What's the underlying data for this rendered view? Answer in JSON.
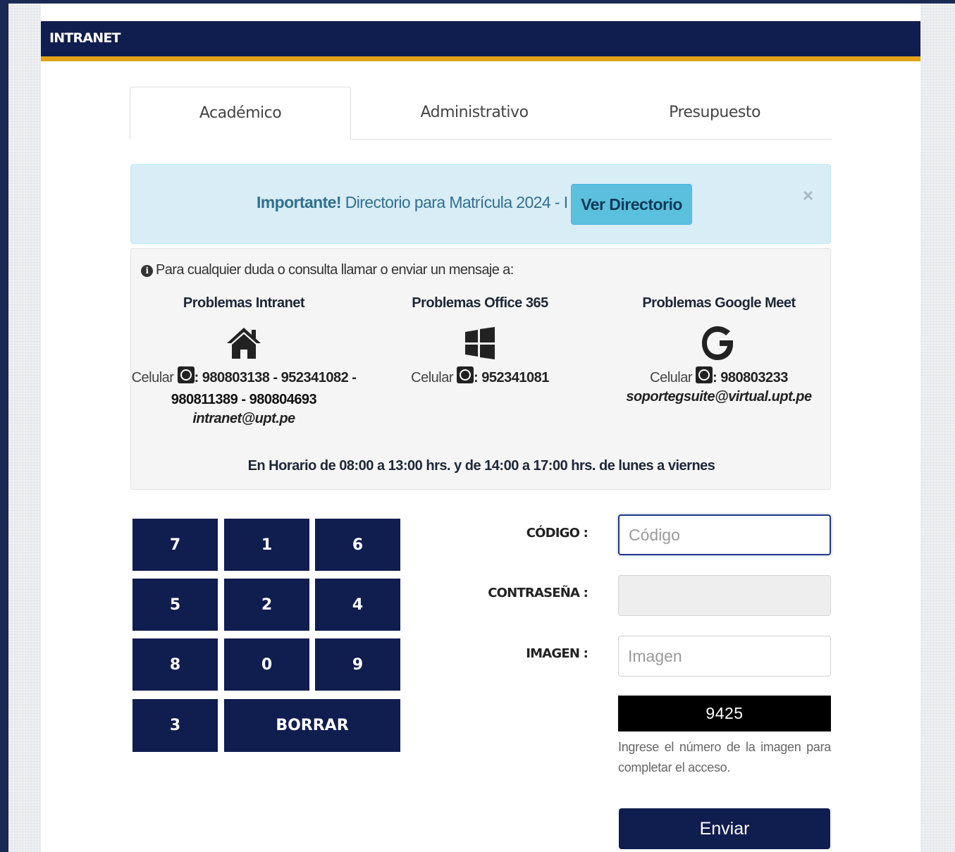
{
  "header": {
    "title": "INTRANET"
  },
  "tabs": [
    {
      "label": "Académico",
      "active": true
    },
    {
      "label": "Administrativo",
      "active": false
    },
    {
      "label": "Presupuesto",
      "active": false
    }
  ],
  "alert": {
    "strong": "Importante!",
    "text": " Directorio para Matrícula 2024 - I",
    "button": "Ver Directorio",
    "close": "×"
  },
  "support": {
    "intro": "Para cualquier duda o consulta llamar o enviar un mensaje a:",
    "columns": [
      {
        "title": "Problemas Intranet",
        "icon": "home-icon",
        "phone_label": "Celular",
        "phones_line1": ": 980803138 - 952341082 -",
        "phones_line2": "980811389 - 980804693",
        "email": "intranet@upt.pe"
      },
      {
        "title": "Problemas Office 365",
        "icon": "windows-icon",
        "phone_label": "Celular",
        "phones_line1": ": 952341081"
      },
      {
        "title": "Problemas Google Meet",
        "icon": "google-icon",
        "phone_label": "Celular",
        "phones_line1": ": 980803233",
        "email": "soportegsuite@virtual.upt.pe"
      }
    ],
    "schedule": "En Horario de 08:00 a 13:00 hrs. y de 14:00 a 17:00 hrs. de lunes a viernes"
  },
  "keypad": {
    "keys": [
      "7",
      "1",
      "6",
      "5",
      "2",
      "4",
      "8",
      "0",
      "9",
      "3"
    ],
    "clear": "BORRAR"
  },
  "form": {
    "code_label": "CÓDIGO :",
    "code_placeholder": "Código",
    "password_label": "CONTRASEÑA :",
    "image_label": "IMAGEN :",
    "image_placeholder": "Imagen",
    "captcha": "9425",
    "help": "Ingrese el número de la imagen para completar el acceso.",
    "submit": "Enviar"
  },
  "colors": {
    "navy": "#101d4f",
    "gold": "#e2a31a",
    "alert_bg": "#d9edf7",
    "alert_button": "#5bc0de"
  }
}
